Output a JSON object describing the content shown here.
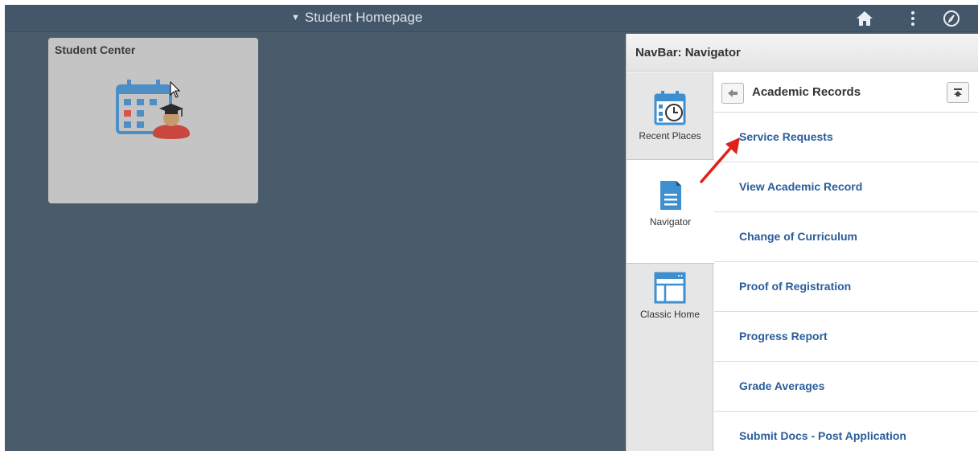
{
  "topbar": {
    "page_title": "Student Homepage",
    "icons": {
      "home": "home-icon",
      "more": "vertical-dots-icon",
      "navbar": "compass-icon"
    }
  },
  "tile": {
    "title": "Student Center",
    "icon": "calendar-graduate-icon"
  },
  "navbar": {
    "title": "NavBar: Navigator",
    "tabs": [
      {
        "label": "Recent Places",
        "icon": "calendar-clock-icon"
      },
      {
        "label": "Navigator",
        "icon": "document-icon"
      },
      {
        "label": "Classic Home",
        "icon": "browser-window-icon"
      }
    ],
    "list": {
      "title": "Academic Records",
      "items": [
        "Service Requests",
        "View Academic Record",
        "Change of Curriculum",
        "Proof of Registration",
        "Progress Report",
        "Grade Averages",
        "Submit Docs - Post Application"
      ]
    }
  },
  "colors": {
    "background": "#4a5b6b",
    "topbar": "#44576a",
    "link": "#2a5d9b",
    "annotation_arrow": "#e0201b"
  }
}
